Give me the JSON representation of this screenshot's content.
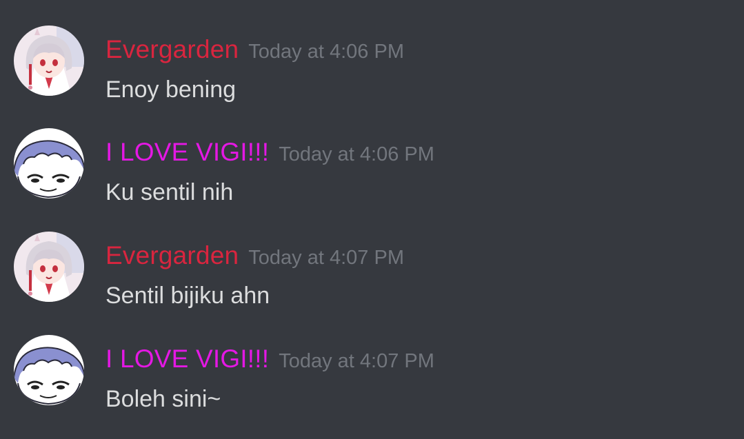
{
  "colors": {
    "background": "#36393f",
    "evergarden": "#d9253f",
    "vigi": "#e418e4",
    "timestamp": "#72767d",
    "message_text": "#dcddde"
  },
  "messages": [
    {
      "author": "Evergarden",
      "avatar_icon": "anime-girl-avatar-icon",
      "timestamp": "Today at 4:06 PM",
      "text": "Enoy bening"
    },
    {
      "author": "I LOVE VIGI!!!",
      "avatar_icon": "sketch-face-avatar-icon",
      "timestamp": "Today at 4:06 PM",
      "text": "Ku sentil nih"
    },
    {
      "author": "Evergarden",
      "avatar_icon": "anime-girl-avatar-icon",
      "timestamp": "Today at 4:07 PM",
      "text": "Sentil bijiku ahn"
    },
    {
      "author": "I LOVE VIGI!!!",
      "avatar_icon": "sketch-face-avatar-icon",
      "timestamp": "Today at 4:07 PM",
      "text": "Boleh sini~"
    }
  ]
}
